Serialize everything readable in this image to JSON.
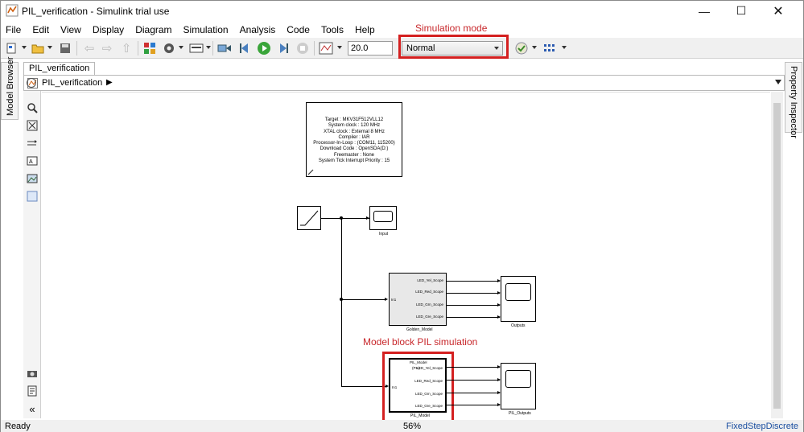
{
  "window": {
    "title": "PIL_verification - Simulink trial use"
  },
  "menu": [
    "File",
    "Edit",
    "View",
    "Display",
    "Diagram",
    "Simulation",
    "Analysis",
    "Code",
    "Tools",
    "Help"
  ],
  "toolbar": {
    "stop_time": "20.0",
    "simulation_mode": "Normal"
  },
  "annotations": {
    "sim_mode": "Simulation mode",
    "pil": "Model block PIL simulation"
  },
  "side": {
    "left_tab": "Model Browser",
    "right_tab": "Property Inspector"
  },
  "editor": {
    "tab": "PIL_verification",
    "breadcrumb": "PIL_verification"
  },
  "diagram": {
    "note_lines": [
      "Target : MKV31F512VLL12",
      "System clock : 120 MHz",
      "XTAL clock : External 8 MHz",
      "Compiler : IAR",
      "Processor-In-Loop : (COM11, 115200)",
      "Download Code : OpenSDA(D:)",
      "Freemaster : None",
      "System Tick Interrupt Priority : 15"
    ],
    "input_scope": "Input",
    "golden_model": "Golden_Model",
    "outputs_scope": "Outputs",
    "pil_model": "PIL_Model",
    "pil_model_top": "PIL_Model",
    "pil_tag": "(PIL)",
    "pil_outputs": "PIL_Outputs",
    "in_port": "In1",
    "ports": [
      "LED_Yel_Scope",
      "LED_Red_Scope",
      "LED_Grn_Scope",
      "LED_Gre_Scope"
    ]
  },
  "status": {
    "left": "Ready",
    "zoom": "56%",
    "solver": "FixedStepDiscrete"
  }
}
